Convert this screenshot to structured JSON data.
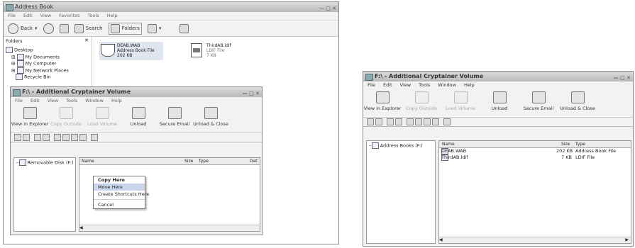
{
  "left": {
    "explorer": {
      "title": "Address Book",
      "menu": [
        "File",
        "Edit",
        "View",
        "Favorites",
        "Tools",
        "Help"
      ],
      "toolbar": {
        "back": "Back",
        "search": "Search",
        "folders": "Folders"
      },
      "folders_label": "Folders",
      "tree": [
        "Desktop",
        "My Documents",
        "My Computer",
        "My Network Places",
        "Recycle Bin"
      ],
      "file1": {
        "name": "DEAB.WAB",
        "type": "Address Book File",
        "size": "202 KB"
      },
      "file2": {
        "name": "ThirdAB.ldif",
        "type": "LDIF File",
        "size": "7 KB"
      }
    },
    "vol": {
      "title": "F:\\ - Additional Cryptainer Volume",
      "menu": [
        "File",
        "Edit",
        "View",
        "Tools",
        "Window",
        "Help"
      ],
      "buttons": [
        "View in Explorer",
        "Copy Outside",
        "Load Volume",
        "Unload",
        "Secure Email",
        "Unload & Close"
      ],
      "tree_item": "Removable Disk (F:)",
      "cols": {
        "name": "Name",
        "size": "Size",
        "type": "Type",
        "date": "Dat"
      },
      "context_menu": [
        "Copy Here",
        "Move Here",
        "Create Shortcuts Here",
        "Cancel"
      ]
    }
  },
  "right": {
    "vol": {
      "title": "F:\\ - Additional Cryptainer Volume",
      "menu": [
        "File",
        "Edit",
        "View",
        "Tools",
        "Window",
        "Help"
      ],
      "buttons": [
        "View in Explorer",
        "Copy Outside",
        "Load Volume",
        "Unload",
        "Secure Email",
        "Unload & Close"
      ],
      "tree_item": "Address Books (F:)",
      "cols": {
        "name": "Name",
        "size": "Size",
        "type": "Type"
      },
      "rows": [
        {
          "name": "DEAB.WAB",
          "size": "202 KB",
          "type": "Address Book File"
        },
        {
          "name": "ThirdAB.ldif",
          "size": "7 KB",
          "type": "LDIF File"
        }
      ]
    }
  }
}
